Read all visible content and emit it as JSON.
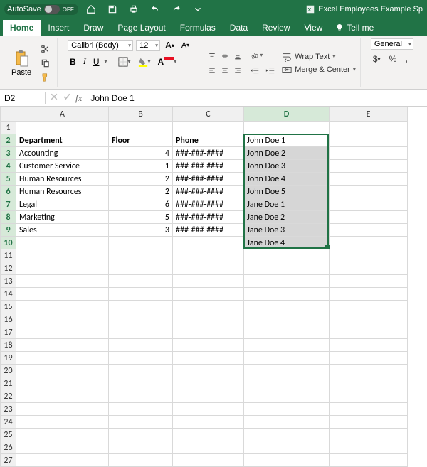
{
  "titlebar": {
    "autosave_label": "AutoSave",
    "autosave_state": "OFF",
    "doc_title": "Excel Employees Example Sp"
  },
  "tabs": {
    "items": [
      "Home",
      "Insert",
      "Draw",
      "Page Layout",
      "Formulas",
      "Data",
      "Review",
      "View"
    ],
    "active": "Home",
    "tellme": "Tell me"
  },
  "ribbon": {
    "paste_label": "Paste",
    "font_name": "Calibri (Body)",
    "font_size": "12",
    "wrap_text": "Wrap Text",
    "merge_center": "Merge & Center",
    "number_format": "General",
    "group_clipboard": "",
    "group_font": "",
    "group_align": "",
    "group_number": ""
  },
  "namebox": {
    "cell_ref": "D2",
    "formula": "John Doe 1"
  },
  "columns": [
    "A",
    "B",
    "C",
    "D",
    "E"
  ],
  "headers": {
    "A": "Department",
    "B": "Floor",
    "C": "Phone"
  },
  "rows": [
    {
      "A": "Accounting",
      "B": "4",
      "C": "###-###-####",
      "D": "John Doe 1"
    },
    {
      "A": "Accounting",
      "B": "4",
      "C": "###-###-####",
      "D": "John Doe 2"
    },
    {
      "A": "Customer Service",
      "B": "1",
      "C": "###-###-####",
      "D": "John Doe 3"
    },
    {
      "A": "Human Resources",
      "B": "2",
      "C": "###-###-####",
      "D": "John Doe 4"
    },
    {
      "A": "Human Resources",
      "B": "2",
      "C": "###-###-####",
      "D": "John Doe 5"
    },
    {
      "A": "Legal",
      "B": "6",
      "C": "###-###-####",
      "D": "Jane Doe 1"
    },
    {
      "A": "Marketing",
      "B": "5",
      "C": "###-###-####",
      "D": "Jane Doe 2"
    },
    {
      "A": "Sales",
      "B": "3",
      "C": "###-###-####",
      "D": "Jane Doe 3"
    },
    {
      "A": "",
      "B": "",
      "C": "",
      "D": "Jane Doe 4"
    }
  ],
  "selection": {
    "col": "D",
    "row_start": 2,
    "row_end": 10
  },
  "visible_row_count": 27,
  "colors": {
    "accent": "#217346"
  }
}
